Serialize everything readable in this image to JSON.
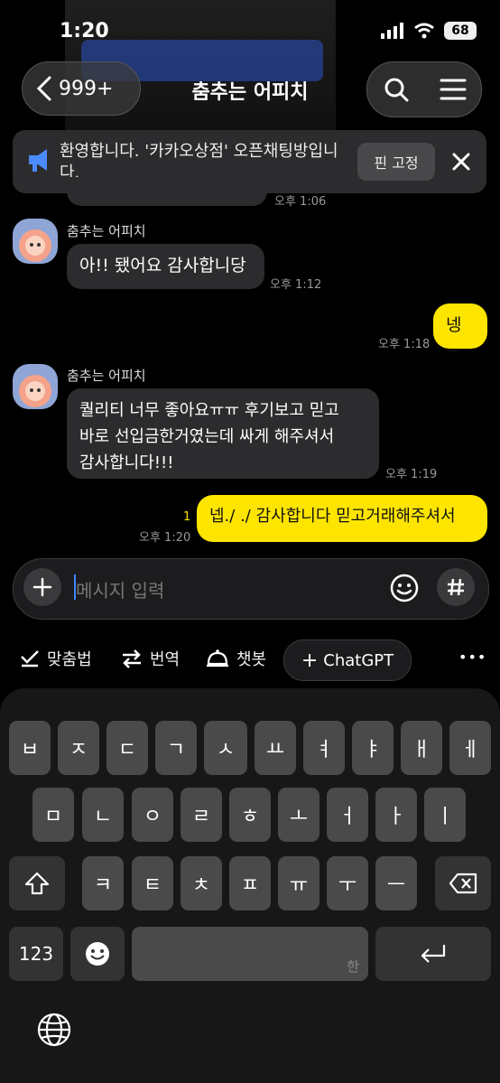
{
  "status": {
    "time": "1:20",
    "battery": "68"
  },
  "header": {
    "back_count": "999+",
    "title": "춤추는 어피치"
  },
  "notice": {
    "text": "환영합니다. '카카오상점' 오픈채팅방입니다.",
    "pin_label": "핀 고정"
  },
  "messages": [
    {
      "time": "오후 1:06"
    },
    {
      "sender": "춤추는 어피치",
      "text": "아!! 됐어요 감사합니당",
      "time": "오후 1:12"
    },
    {
      "text": "넹~",
      "time": "오후 1:18"
    },
    {
      "sender": "춤추는 어피치",
      "lines": [
        "퀄리티 너무 좋아요ㅠㅠ 후기보고 믿고",
        "바로 선입금한거였는데 싸게 해주셔서",
        "감사합니다!!!"
      ],
      "time": "오후 1:19"
    },
    {
      "text": "넵./ ./ 감사합니다 믿고거래해주셔서",
      "time": "오후 1:20",
      "unread": "1"
    }
  ],
  "input": {
    "placeholder": "메시지 입력"
  },
  "toolbar": {
    "spell": "맞춤법",
    "translate": "번역",
    "chatbot": "챗봇",
    "chatgpt": "ChatGPT",
    "more": "•••"
  },
  "keyboard": {
    "row1": [
      "ㅂ",
      "ㅈ",
      "ㄷ",
      "ㄱ",
      "ㅅ",
      "ㅛ",
      "ㅕ",
      "ㅑ",
      "ㅐ",
      "ㅔ"
    ],
    "row2": [
      "ㅁ",
      "ㄴ",
      "ㅇ",
      "ㄹ",
      "ㅎ",
      "ㅗ",
      "ㅓ",
      "ㅏ",
      "ㅣ"
    ],
    "row3": [
      "ㅋ",
      "ㅌ",
      "ㅊ",
      "ㅍ",
      "ㅠ",
      "ㅜ",
      "ㅡ"
    ],
    "num_label": "123",
    "space_hint": "한"
  },
  "colors": {
    "yellow": "#fee500",
    "bubble_gray": "#2c2c2e",
    "accent_blue": "#3a86ff"
  }
}
